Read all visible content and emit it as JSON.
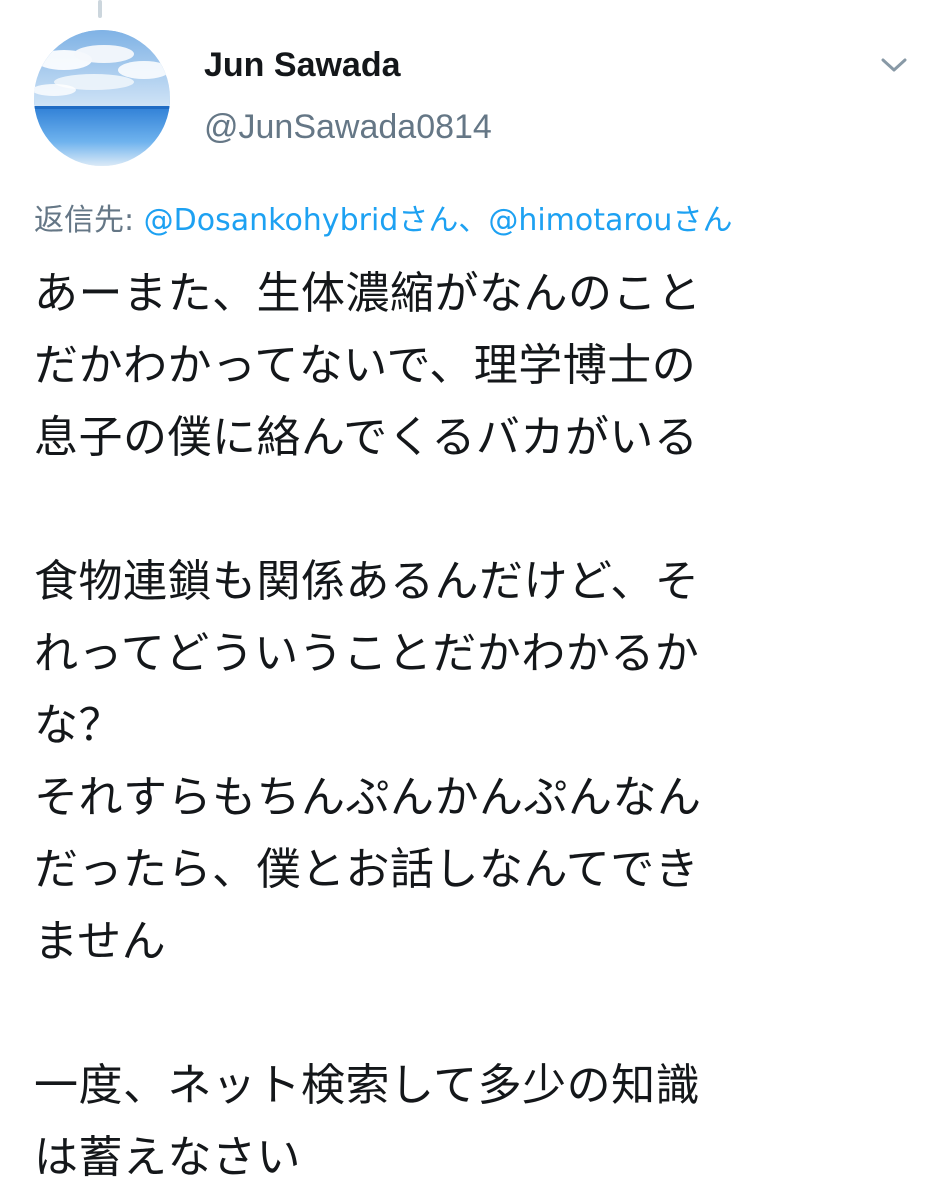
{
  "tweet": {
    "author": {
      "display_name": "Jun Sawada",
      "handle": "@JunSawada0814",
      "avatar_icon": "sky-sea-landscape-avatar"
    },
    "menu_icon": "chevron-down-icon",
    "reply_to": {
      "prefix": "返信先: ",
      "mention_1": "@Dosankohybridさん",
      "separator": "、",
      "mention_2": "@himotarouさん"
    },
    "body_lines": [
      "あーまた、生体濃縮がなんのこと",
      "だかわかってないで、理学博士の",
      "息子の僕に絡んでくるバカがいる",
      "",
      "食物連鎖も関係あるんだけど、そ",
      "れってどういうことだかわかるか",
      "な？",
      "それすらもちんぷんかんぷんなん",
      "だったら、僕とお話しなんてでき",
      "ません",
      "",
      "一度、ネット検索して多少の知識",
      "は蓄えなさい"
    ]
  },
  "colors": {
    "text_primary": "#14171a",
    "text_secondary": "#657786",
    "link": "#1da1f2",
    "thread_line": "#ccd6dd"
  }
}
